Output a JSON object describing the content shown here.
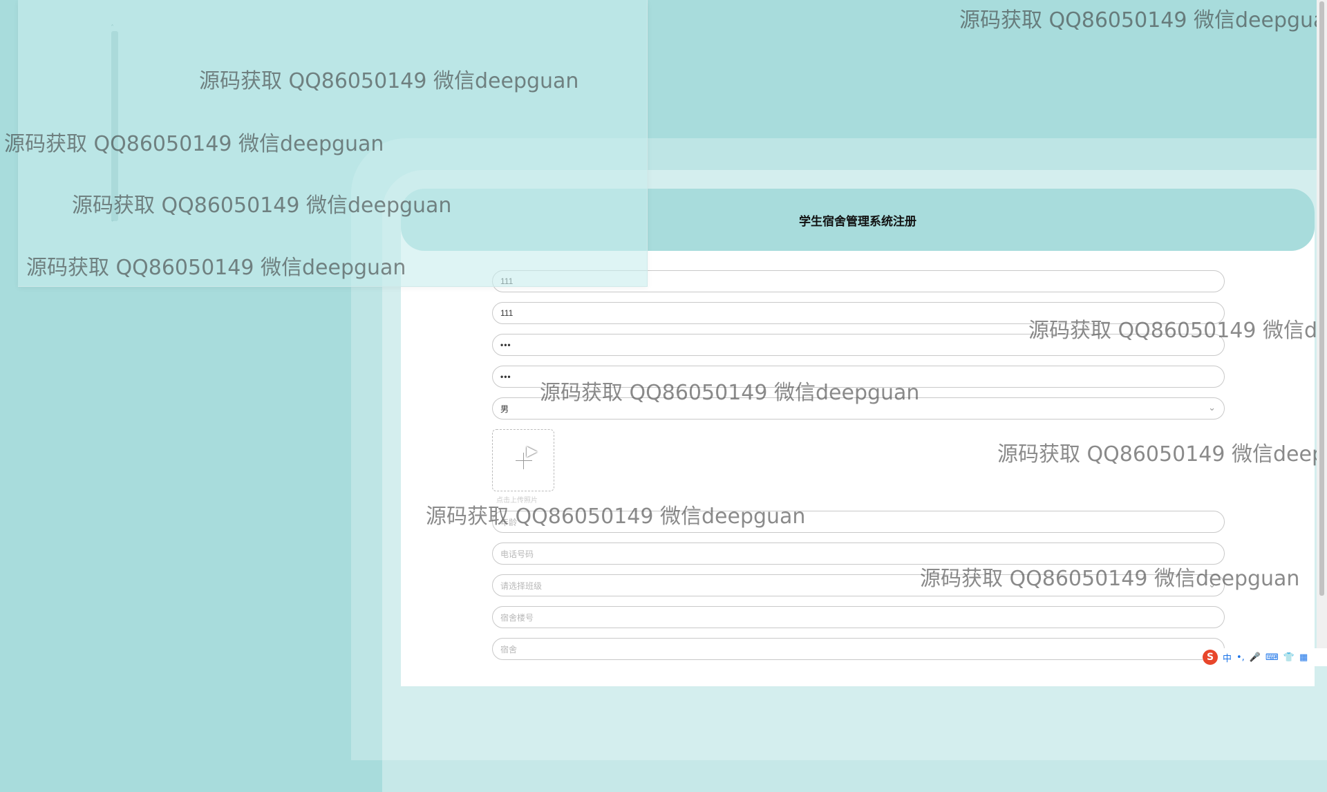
{
  "form": {
    "title": "学生宿舍管理系统注册",
    "fields": {
      "account": {
        "value": "111"
      },
      "name": {
        "value": "111"
      },
      "password": {
        "value": "•••"
      },
      "confirm_password": {
        "value": "•••"
      },
      "gender": {
        "value": "男"
      },
      "photo_hint": "点击上传照片",
      "age": {
        "placeholder": "年龄"
      },
      "phone": {
        "placeholder": "电话号码"
      },
      "class": {
        "placeholder": "请选择班级"
      },
      "dorm_building": {
        "placeholder": "宿舍楼号"
      },
      "dorm": {
        "placeholder": "宿舍"
      }
    }
  },
  "watermark": "源码获取 QQ86050149 微信deepguan",
  "ime": {
    "mode": "中",
    "punct": "•,"
  },
  "icons": [
    "plus-icon",
    "chevron-down-icon",
    "cursor-icon",
    "sogou-ime-icon",
    "mic-icon",
    "keyboard-icon",
    "shirt-icon",
    "grid-icon"
  ]
}
